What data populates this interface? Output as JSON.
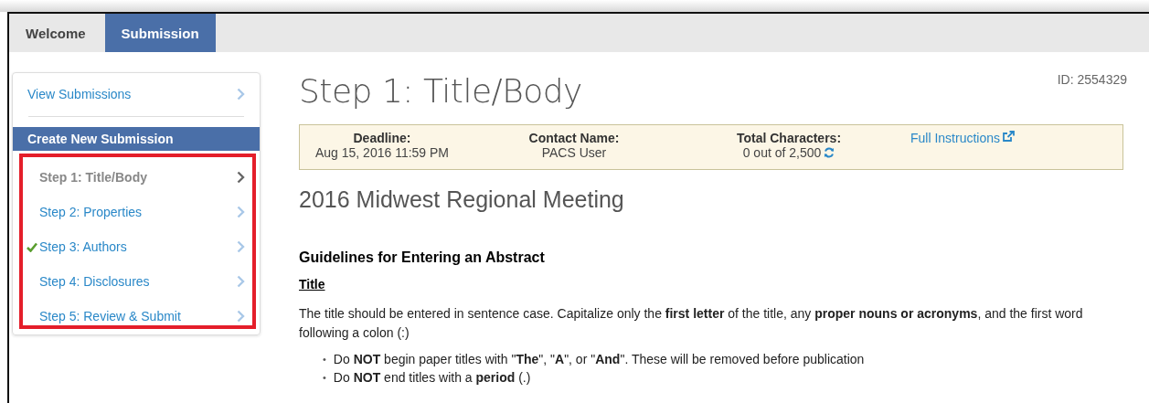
{
  "tabs": [
    {
      "label": "Welcome",
      "selected": false
    },
    {
      "label": "Submission",
      "selected": true
    }
  ],
  "sidebar": {
    "view_link": "View Submissions",
    "section_title": "Create New Submission",
    "steps": [
      {
        "label": "Step 1: Title/Body",
        "selected": true,
        "completed": false
      },
      {
        "label": "Step 2: Properties",
        "selected": false,
        "completed": false
      },
      {
        "label": "Step 3: Authors",
        "selected": false,
        "completed": true
      },
      {
        "label": "Step 4: Disclosures",
        "selected": false,
        "completed": false
      },
      {
        "label": "Step 5: Review & Submit",
        "selected": false,
        "completed": false
      }
    ]
  },
  "main": {
    "title": "Step 1: Title/Body",
    "id": "ID: 2554329",
    "info": [
      {
        "label": "Deadline:",
        "value": "Aug 15, 2016 11:59 PM",
        "kind": "text"
      },
      {
        "label": "Contact Name:",
        "value": "PACS User",
        "kind": "text"
      },
      {
        "label": "Total Characters:",
        "value": "0 out of 2,500",
        "kind": "refresh"
      }
    ],
    "instructions_link": "Full Instructions",
    "meeting": "2016 Midwest Regional Meeting",
    "guidelines_heading": "Guidelines for Entering an Abstract",
    "section_heading": "Title",
    "paragraph": "The title should be entered in sentence case. Capitalize only the **first letter** of the title, any **proper nouns or acronyms**, and the first word following a colon (:)",
    "bullets": [
      {
        "marker": "•",
        "text": "Do **NOT** begin paper titles with \"**The**\", \"**A**\", or \"**And**\". These will be removed before publication"
      },
      {
        "marker": "•",
        "text": "Do **NOT** end titles with a **period** (.)"
      }
    ]
  }
}
